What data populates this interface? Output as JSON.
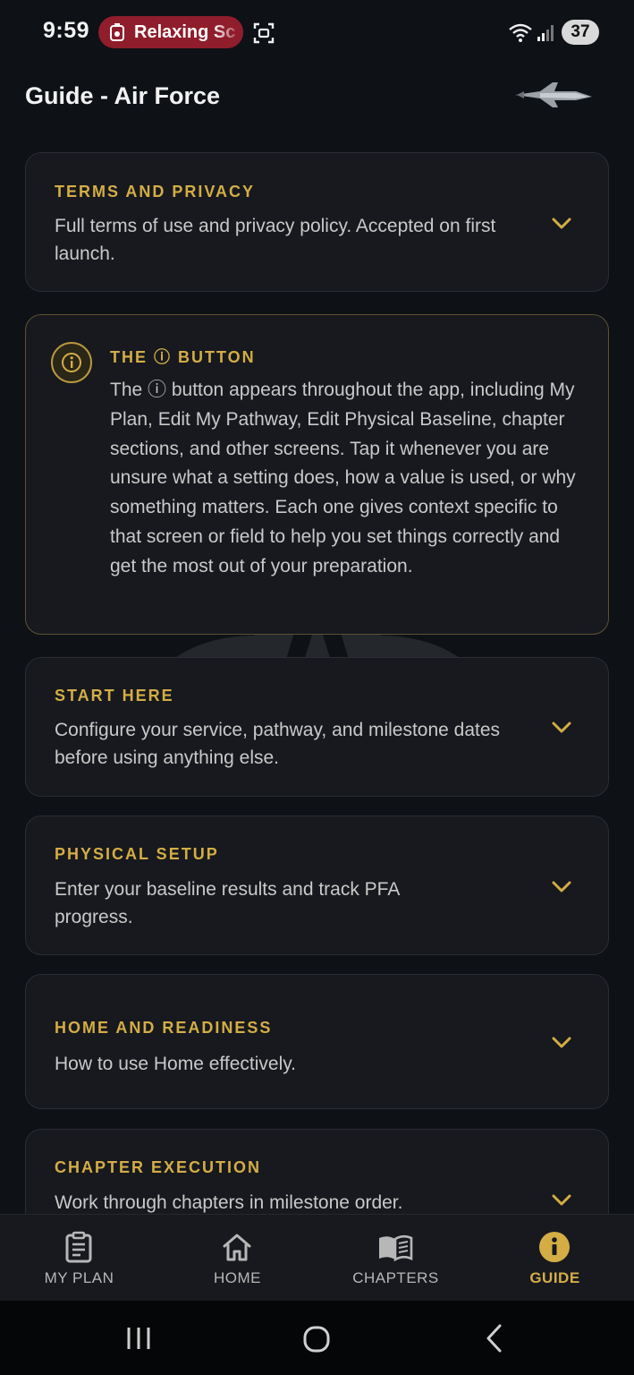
{
  "status_bar": {
    "time": "9:59",
    "media_label": "Relaxing Sc",
    "battery": "37",
    "icons": [
      "media-icon",
      "screenshot-icon",
      "wifi-icon",
      "signal-icon"
    ]
  },
  "header": {
    "title": "Guide - Air Force",
    "logo_icon": "fighter-jet-icon"
  },
  "cards": [
    {
      "title": "TERMS AND PRIVACY",
      "description": "Full terms of use and privacy policy. Accepted on first launch.",
      "expanded": false
    },
    {
      "title": "THE ⓘ BUTTON",
      "description": "The ⓘ button appears throughout the app, including My Plan, Edit My Pathway, Edit Physical Baseline, chapter sections, and other screens. Tap it whenever you are unsure what a setting does, how a value is used, or why something matters. Each one gives context specific to that screen or field to help you set things correctly and get the most out of your preparation.",
      "icon": "info-icon"
    },
    {
      "title": "START HERE",
      "description": "Configure your service, pathway, and milestone dates before using anything else.",
      "expanded": false
    },
    {
      "title": "PHYSICAL SETUP",
      "description": "Enter your baseline results and track PFA progress.",
      "expanded": false
    },
    {
      "title": "HOME AND READINESS",
      "description": "How to use Home effectively.",
      "expanded": false
    },
    {
      "title": "CHAPTER EXECUTION",
      "description": "Work through chapters in milestone order.",
      "expanded": false
    }
  ],
  "bottom_nav": {
    "items": [
      {
        "label": "MY PLAN",
        "icon": "clipboard-icon",
        "active": false
      },
      {
        "label": "HOME",
        "icon": "home-icon",
        "active": false
      },
      {
        "label": "CHAPTERS",
        "icon": "book-icon",
        "active": false
      },
      {
        "label": "GUIDE",
        "icon": "info-icon",
        "active": true
      }
    ]
  },
  "colors": {
    "background": "#0e1116",
    "card": "#17191e",
    "accent": "#d4ad45",
    "media_pill": "#8f1d2c"
  }
}
